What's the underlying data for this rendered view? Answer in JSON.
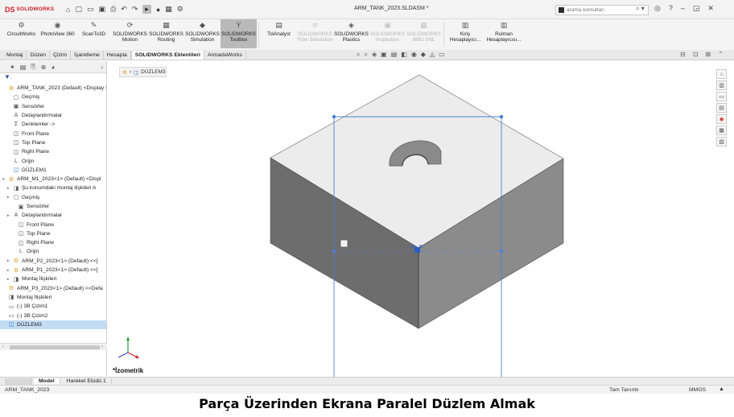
{
  "app": {
    "logo_mark": "DS",
    "logo_text": "SOLIDWORKS",
    "doc_title": "ARM_TANK_2023.SLDASM *"
  },
  "quick_access": [
    "⌂",
    "▢",
    "▭",
    "▣",
    "⎙",
    "↶",
    "↷",
    "▸",
    "●",
    "▦",
    "⚙"
  ],
  "search": {
    "placeholder": "arama komutları"
  },
  "window_controls": [
    "◎",
    "?",
    "–",
    "◲",
    "✕"
  ],
  "ribbon": [
    {
      "label": "CircuitWorks",
      "icon": "⚙",
      "state": "normal"
    },
    {
      "label": "PhotoView 360",
      "icon": "◉",
      "state": "normal"
    },
    {
      "label": "ScanTo3D",
      "icon": "✎",
      "state": "normal"
    },
    {
      "label": "SOLIDWORKS Motion",
      "icon": "⟳",
      "state": "normal"
    },
    {
      "label": "SOLIDWORKS Routing",
      "icon": "▦",
      "state": "normal"
    },
    {
      "label": "SOLIDWORKS Simulation",
      "icon": "◆",
      "state": "normal"
    },
    {
      "label": "SOLIDWORKS Toolbox",
      "icon": "Y",
      "state": "active"
    },
    {
      "label": "TolAnalyst",
      "icon": "▤",
      "state": "normal"
    },
    {
      "label": "SOLIDWORKS Flow Simulation",
      "icon": "≋",
      "state": "disabled"
    },
    {
      "label": "SOLIDWORKS Plastics",
      "icon": "◈",
      "state": "normal"
    },
    {
      "label": "SOLIDWORKS Inspection",
      "icon": "▣",
      "state": "disabled"
    },
    {
      "label": "SOLIDWORKS MBD SNL",
      "icon": "▦",
      "state": "disabled"
    },
    {
      "label": "Kiriş Hesaplayıcı...",
      "icon": "▥",
      "state": "normal"
    },
    {
      "label": "Rulman Hesaplayıcısı...",
      "icon": "▥",
      "state": "normal"
    }
  ],
  "tabs": [
    {
      "label": "Montaj",
      "active": false
    },
    {
      "label": "Düzen",
      "active": false
    },
    {
      "label": "Çizim",
      "active": false
    },
    {
      "label": "İşaretleme",
      "active": false
    },
    {
      "label": "Hesapla",
      "active": false
    },
    {
      "label": "SOLIDWORKS Eklentileri",
      "active": true
    },
    {
      "label": "ArmadaWorks",
      "active": false
    }
  ],
  "panel": {
    "filter_icon": "▼.",
    "tree": [
      {
        "label": "ARM_TANK_2023 (Default) <Display St",
        "icon": "⚙",
        "color": "yel",
        "indent": 0,
        "tri": ""
      },
      {
        "label": "Geçmiş",
        "icon": "▢",
        "indent": 1,
        "tri": ""
      },
      {
        "label": "Sensörler",
        "icon": "▣",
        "indent": 1,
        "tri": ""
      },
      {
        "label": "Detaylandırmalar",
        "icon": "A",
        "indent": 1,
        "tri": ""
      },
      {
        "label": "Denklemler ->",
        "icon": "Σ",
        "indent": 1,
        "tri": ""
      },
      {
        "label": "Front Plane",
        "icon": "◫",
        "indent": 1,
        "tri": ""
      },
      {
        "label": "Top Plane",
        "icon": "◫",
        "indent": 1,
        "tri": ""
      },
      {
        "label": "Right Plane",
        "icon": "◫",
        "indent": 1,
        "tri": ""
      },
      {
        "label": "Orijin",
        "icon": "L",
        "indent": 1,
        "tri": ""
      },
      {
        "label": "DÜZLEM1",
        "icon": "◫",
        "color": "blu",
        "indent": 1,
        "tri": ""
      },
      {
        "label": "ARM_M1_2023<1> (Default) <Displ",
        "icon": "⚙",
        "color": "yel",
        "indent": 0,
        "tri": "▾"
      },
      {
        "label": "Şu konumdaki montaj ilişkileri A",
        "icon": "◨",
        "indent": 1,
        "tri": "▸"
      },
      {
        "label": "Geçmiş",
        "icon": "▢",
        "indent": 1,
        "tri": "▸"
      },
      {
        "label": "Sensörler",
        "icon": "▣",
        "indent": 2,
        "tri": ""
      },
      {
        "label": "Detaylandırmalar",
        "icon": "A",
        "indent": 1,
        "tri": "▸"
      },
      {
        "label": "Front Plane",
        "icon": "◫",
        "indent": 2,
        "tri": ""
      },
      {
        "label": "Top Plane",
        "icon": "◫",
        "indent": 2,
        "tri": ""
      },
      {
        "label": "Right Plane",
        "icon": "◫",
        "indent": 2,
        "tri": ""
      },
      {
        "label": "Orijin",
        "icon": "L",
        "indent": 2,
        "tri": ""
      },
      {
        "label": "ARM_P2_2023<1> (Default) <<[",
        "icon": "⚙",
        "color": "yel",
        "indent": 1,
        "tri": "▸"
      },
      {
        "label": "ARM_P1_2023<1> (Default) <<[",
        "icon": "⚙",
        "color": "yel",
        "indent": 1,
        "tri": "▸"
      },
      {
        "label": "Montaj İlişkileri",
        "icon": "◨",
        "indent": 1,
        "tri": "▸"
      },
      {
        "label": "ARM_P3_2023<1> (Default) <<Defa",
        "icon": "⚙",
        "color": "yel",
        "indent": 0,
        "tri": ""
      },
      {
        "label": "Montaj İlişkileri",
        "icon": "◨",
        "indent": 0,
        "tri": ""
      },
      {
        "label": "(-) 3B Çizim1",
        "icon": "▭",
        "indent": 0,
        "tri": ""
      },
      {
        "label": "(-) 3B Çizim2",
        "icon": "▭",
        "indent": 0,
        "tri": ""
      },
      {
        "label": "DÜZLEM3",
        "icon": "◫",
        "color": "blu",
        "indent": 0,
        "tri": "",
        "selected": true
      }
    ]
  },
  "viewport": {
    "flyout_label": "DÜZLEM3",
    "view_name": "*İzometrik"
  },
  "model_tabs": [
    {
      "label": "",
      "ghost": true
    },
    {
      "label": "Model",
      "active": true
    },
    {
      "label": "Hareket Etüdü 1",
      "active": false
    }
  ],
  "status": {
    "left": "ARM_TANK_2023",
    "mid": "Tam Tanımlı",
    "right": "MMGS",
    "arrow": "▲"
  },
  "caption": "Parça Üzerinden Ekrana Paralel Düzlem Almak",
  "colors": {
    "plane": "#4a7fd6",
    "box_top": "#ededed",
    "box_left": "#6b6b6b",
    "box_right": "#8a8a8a"
  }
}
